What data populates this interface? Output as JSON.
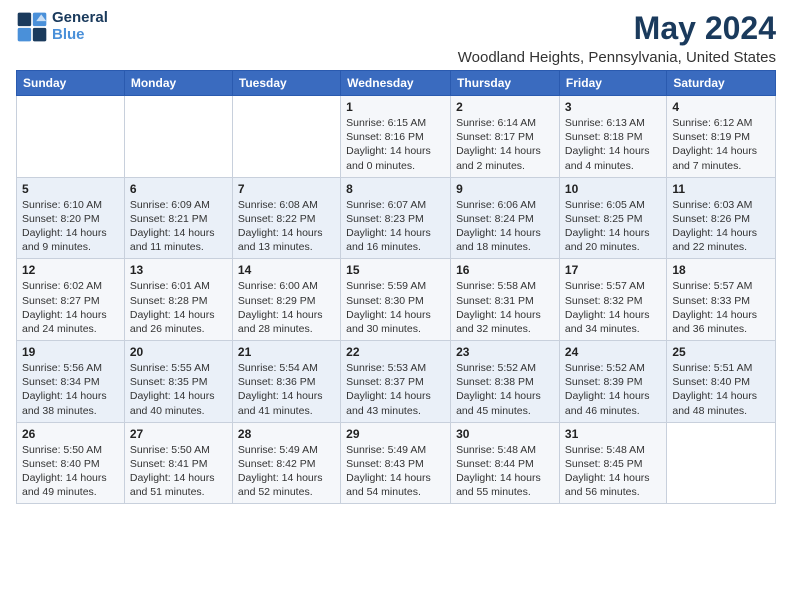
{
  "header": {
    "logo_line1": "General",
    "logo_line2": "Blue",
    "main_title": "May 2024",
    "subtitle": "Woodland Heights, Pennsylvania, United States"
  },
  "days_of_week": [
    "Sunday",
    "Monday",
    "Tuesday",
    "Wednesday",
    "Thursday",
    "Friday",
    "Saturday"
  ],
  "weeks": [
    [
      {
        "num": "",
        "detail": ""
      },
      {
        "num": "",
        "detail": ""
      },
      {
        "num": "",
        "detail": ""
      },
      {
        "num": "1",
        "detail": "Sunrise: 6:15 AM\nSunset: 8:16 PM\nDaylight: 14 hours\nand 0 minutes."
      },
      {
        "num": "2",
        "detail": "Sunrise: 6:14 AM\nSunset: 8:17 PM\nDaylight: 14 hours\nand 2 minutes."
      },
      {
        "num": "3",
        "detail": "Sunrise: 6:13 AM\nSunset: 8:18 PM\nDaylight: 14 hours\nand 4 minutes."
      },
      {
        "num": "4",
        "detail": "Sunrise: 6:12 AM\nSunset: 8:19 PM\nDaylight: 14 hours\nand 7 minutes."
      }
    ],
    [
      {
        "num": "5",
        "detail": "Sunrise: 6:10 AM\nSunset: 8:20 PM\nDaylight: 14 hours\nand 9 minutes."
      },
      {
        "num": "6",
        "detail": "Sunrise: 6:09 AM\nSunset: 8:21 PM\nDaylight: 14 hours\nand 11 minutes."
      },
      {
        "num": "7",
        "detail": "Sunrise: 6:08 AM\nSunset: 8:22 PM\nDaylight: 14 hours\nand 13 minutes."
      },
      {
        "num": "8",
        "detail": "Sunrise: 6:07 AM\nSunset: 8:23 PM\nDaylight: 14 hours\nand 16 minutes."
      },
      {
        "num": "9",
        "detail": "Sunrise: 6:06 AM\nSunset: 8:24 PM\nDaylight: 14 hours\nand 18 minutes."
      },
      {
        "num": "10",
        "detail": "Sunrise: 6:05 AM\nSunset: 8:25 PM\nDaylight: 14 hours\nand 20 minutes."
      },
      {
        "num": "11",
        "detail": "Sunrise: 6:03 AM\nSunset: 8:26 PM\nDaylight: 14 hours\nand 22 minutes."
      }
    ],
    [
      {
        "num": "12",
        "detail": "Sunrise: 6:02 AM\nSunset: 8:27 PM\nDaylight: 14 hours\nand 24 minutes."
      },
      {
        "num": "13",
        "detail": "Sunrise: 6:01 AM\nSunset: 8:28 PM\nDaylight: 14 hours\nand 26 minutes."
      },
      {
        "num": "14",
        "detail": "Sunrise: 6:00 AM\nSunset: 8:29 PM\nDaylight: 14 hours\nand 28 minutes."
      },
      {
        "num": "15",
        "detail": "Sunrise: 5:59 AM\nSunset: 8:30 PM\nDaylight: 14 hours\nand 30 minutes."
      },
      {
        "num": "16",
        "detail": "Sunrise: 5:58 AM\nSunset: 8:31 PM\nDaylight: 14 hours\nand 32 minutes."
      },
      {
        "num": "17",
        "detail": "Sunrise: 5:57 AM\nSunset: 8:32 PM\nDaylight: 14 hours\nand 34 minutes."
      },
      {
        "num": "18",
        "detail": "Sunrise: 5:57 AM\nSunset: 8:33 PM\nDaylight: 14 hours\nand 36 minutes."
      }
    ],
    [
      {
        "num": "19",
        "detail": "Sunrise: 5:56 AM\nSunset: 8:34 PM\nDaylight: 14 hours\nand 38 minutes."
      },
      {
        "num": "20",
        "detail": "Sunrise: 5:55 AM\nSunset: 8:35 PM\nDaylight: 14 hours\nand 40 minutes."
      },
      {
        "num": "21",
        "detail": "Sunrise: 5:54 AM\nSunset: 8:36 PM\nDaylight: 14 hours\nand 41 minutes."
      },
      {
        "num": "22",
        "detail": "Sunrise: 5:53 AM\nSunset: 8:37 PM\nDaylight: 14 hours\nand 43 minutes."
      },
      {
        "num": "23",
        "detail": "Sunrise: 5:52 AM\nSunset: 8:38 PM\nDaylight: 14 hours\nand 45 minutes."
      },
      {
        "num": "24",
        "detail": "Sunrise: 5:52 AM\nSunset: 8:39 PM\nDaylight: 14 hours\nand 46 minutes."
      },
      {
        "num": "25",
        "detail": "Sunrise: 5:51 AM\nSunset: 8:40 PM\nDaylight: 14 hours\nand 48 minutes."
      }
    ],
    [
      {
        "num": "26",
        "detail": "Sunrise: 5:50 AM\nSunset: 8:40 PM\nDaylight: 14 hours\nand 49 minutes."
      },
      {
        "num": "27",
        "detail": "Sunrise: 5:50 AM\nSunset: 8:41 PM\nDaylight: 14 hours\nand 51 minutes."
      },
      {
        "num": "28",
        "detail": "Sunrise: 5:49 AM\nSunset: 8:42 PM\nDaylight: 14 hours\nand 52 minutes."
      },
      {
        "num": "29",
        "detail": "Sunrise: 5:49 AM\nSunset: 8:43 PM\nDaylight: 14 hours\nand 54 minutes."
      },
      {
        "num": "30",
        "detail": "Sunrise: 5:48 AM\nSunset: 8:44 PM\nDaylight: 14 hours\nand 55 minutes."
      },
      {
        "num": "31",
        "detail": "Sunrise: 5:48 AM\nSunset: 8:45 PM\nDaylight: 14 hours\nand 56 minutes."
      },
      {
        "num": "",
        "detail": ""
      }
    ]
  ]
}
